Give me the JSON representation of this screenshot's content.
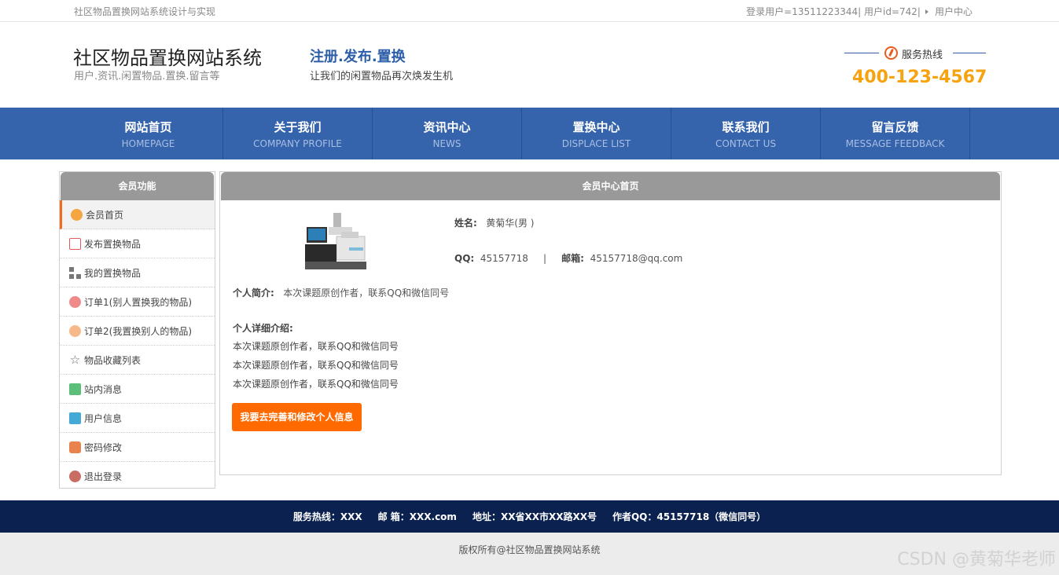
{
  "topbar": {
    "site_title": "社区物品置换网站系统设计与实现",
    "login_info": "登录用户=13511223344| 用户id=742|",
    "user_center": "用户中心"
  },
  "header": {
    "logo_title": "社区物品置换网站系统",
    "logo_sub": "用户.资讯.闲置物品.置换.留言等",
    "slogan_title": "注册.发布.置换",
    "slogan_sub": "让我们的闲置物品再次焕发生机",
    "hotline_label": "服务热线",
    "hotline_number": "400-123-4567"
  },
  "nav": [
    {
      "cn": "网站首页",
      "en": "HOMEPAGE"
    },
    {
      "cn": "关于我们",
      "en": "COMPANY PROFILE"
    },
    {
      "cn": "资讯中心",
      "en": "NEWS"
    },
    {
      "cn": "置换中心",
      "en": "DISPLACE LIST"
    },
    {
      "cn": "联系我们",
      "en": "CONTACT US"
    },
    {
      "cn": "留言反馈",
      "en": "MESSAGE FEEDBACK"
    }
  ],
  "sidebar": {
    "title": "会员功能",
    "items": [
      {
        "label": "会员首页",
        "icon": "home-icon"
      },
      {
        "label": "发布置换物品",
        "icon": "edit-icon"
      },
      {
        "label": "我的置换物品",
        "icon": "grid-icon"
      },
      {
        "label": "订单1(别人置换我的物品)",
        "icon": "order-icon"
      },
      {
        "label": "订单2(我置换别人的物品)",
        "icon": "order-icon"
      },
      {
        "label": "物品收藏列表",
        "icon": "star-icon"
      },
      {
        "label": "站内消息",
        "icon": "message-icon"
      },
      {
        "label": "用户信息",
        "icon": "user-icon"
      },
      {
        "label": "密码修改",
        "icon": "lock-icon"
      },
      {
        "label": "退出登录",
        "icon": "power-icon"
      }
    ]
  },
  "main": {
    "title": "会员中心首页",
    "name_label": "姓名:",
    "name_value": "黄菊华(男 )",
    "qq_label": "QQ:",
    "qq_value": "45157718",
    "separator": "|",
    "email_label": "邮箱:",
    "email_value": "45157718@qq.com",
    "intro_label": "个人简介:",
    "intro_value": "本次课题原创作者，联系QQ和微信同号",
    "detail_title": "个人详细介绍:",
    "detail_lines": [
      "本次课题原创作者，联系QQ和微信同号",
      "本次课题原创作者，联系QQ和微信同号",
      "本次课题原创作者，联系QQ和微信同号"
    ],
    "edit_button": "我要去完善和修改个人信息"
  },
  "footer": {
    "hotline": "服务热线：XXX",
    "email": "邮 箱：XXX.com",
    "address": "地址：XX省XX市XX路XX号",
    "author_qq": "作者QQ：45157718（微信同号）",
    "copyright": "版权所有@社区物品置换网站系统",
    "watermark": "CSDN @黄菊华老师"
  },
  "colors": {
    "nav_blue": "#3563ac",
    "hotline_orange": "#f7a20f",
    "button_orange": "#ff6a00",
    "footer_navy": "#0b2250"
  }
}
